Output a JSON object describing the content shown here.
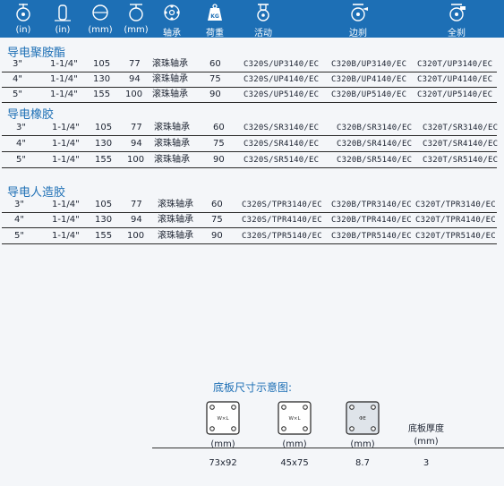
{
  "header": {
    "columns": [
      {
        "icon": "caster-height-icon",
        "label": "(in)"
      },
      {
        "icon": "wheel-width-icon",
        "label": "(in)"
      },
      {
        "icon": "wheel-diameter-icon",
        "label": "(mm)"
      },
      {
        "icon": "mounting-height-icon",
        "label": "(mm)"
      },
      {
        "icon": "bearing-icon",
        "label": "轴承"
      },
      {
        "icon": "load-weight-icon",
        "label": "荷重",
        "badge": "KG"
      },
      {
        "icon": "swivel-caster-icon",
        "label": "活动"
      },
      {
        "icon": "side-brake-caster-icon",
        "label": "边刹"
      },
      {
        "icon": "total-brake-caster-icon",
        "label": "全刹"
      }
    ]
  },
  "sections": [
    {
      "title": "导电聚胺酯",
      "rows": [
        {
          "size": "3\"",
          "width": "1-1/4\"",
          "dia": "105",
          "height": "77",
          "bearing": "滚珠轴承",
          "load": "60",
          "swivel": "C320S/UP3140/EC",
          "side_brake": "C320B/UP3140/EC",
          "total_brake": "C320T/UP3140/EC"
        },
        {
          "size": "4\"",
          "width": "1-1/4\"",
          "dia": "130",
          "height": "94",
          "bearing": "滚珠轴承",
          "load": "75",
          "swivel": "C320S/UP4140/EC",
          "side_brake": "C320B/UP4140/EC",
          "total_brake": "C320T/UP4140/EC"
        },
        {
          "size": "5\"",
          "width": "1-1/4\"",
          "dia": "155",
          "height": "100",
          "bearing": "滚珠轴承",
          "load": "90",
          "swivel": "C320S/UP5140/EC",
          "side_brake": "C320B/UP5140/EC",
          "total_brake": "C320T/UP5140/EC"
        }
      ]
    },
    {
      "title": "导电橡胶",
      "rows": [
        {
          "size": "3\"",
          "width": "1-1/4\"",
          "dia": "105",
          "height": "77",
          "bearing": "滚珠轴承",
          "load": "60",
          "swivel": "C320S/SR3140/EC",
          "side_brake": "C320B/SR3140/EC",
          "total_brake": "C320T/SR3140/EC"
        },
        {
          "size": "4\"",
          "width": "1-1/4\"",
          "dia": "130",
          "height": "94",
          "bearing": "滚珠轴承",
          "load": "75",
          "swivel": "C320S/SR4140/EC",
          "side_brake": "C320B/SR4140/EC",
          "total_brake": "C320T/SR4140/EC"
        },
        {
          "size": "5\"",
          "width": "1-1/4\"",
          "dia": "155",
          "height": "100",
          "bearing": "滚珠轴承",
          "load": "90",
          "swivel": "C320S/SR5140/EC",
          "side_brake": "C320B/SR5140/EC",
          "total_brake": "C320T/SR5140/EC"
        }
      ]
    },
    {
      "title": "导电人造胶",
      "rows": [
        {
          "size": "3\"",
          "width": "1-1/4\"",
          "dia": "105",
          "height": "77",
          "bearing": "滚珠轴承",
          "load": "60",
          "swivel": "C320S/TPR3140/EC",
          "side_brake": "C320B/TPR3140/EC",
          "total_brake": "C320T/TPR3140/EC"
        },
        {
          "size": "4\"",
          "width": "1-1/4\"",
          "dia": "130",
          "height": "94",
          "bearing": "滚珠轴承",
          "load": "75",
          "swivel": "C320S/TPR4140/EC",
          "side_brake": "C320B/TPR4140/EC",
          "total_brake": "C320T/TPR4140/EC"
        },
        {
          "size": "5\"",
          "width": "1-1/4\"",
          "dia": "155",
          "height": "100",
          "bearing": "滚珠轴承",
          "load": "90",
          "swivel": "C320S/TPR5140/EC",
          "side_brake": "C320B/TPR5140/EC",
          "total_brake": "C320T/TPR5140/EC"
        }
      ]
    }
  ],
  "plate": {
    "title": "底板尺寸示意图:",
    "items": [
      {
        "diagram": "plate-size-icon",
        "mark": "W×L",
        "unit": "(mm)",
        "value": "73x92"
      },
      {
        "diagram": "bolt-hole-spacing-icon",
        "mark": "W×L",
        "unit": "(mm)",
        "value": "45x75"
      },
      {
        "diagram": "bolt-hole-diameter-icon",
        "mark": "ΦE",
        "unit": "(mm)",
        "value": "8.7"
      },
      {
        "diagram": "",
        "label": "底板厚度",
        "unit": "(mm)",
        "value": "3"
      }
    ]
  },
  "colors": {
    "header_bg": "#1d6fb5",
    "title": "#1d6fb5",
    "page_bg": "#f4f6f9"
  }
}
